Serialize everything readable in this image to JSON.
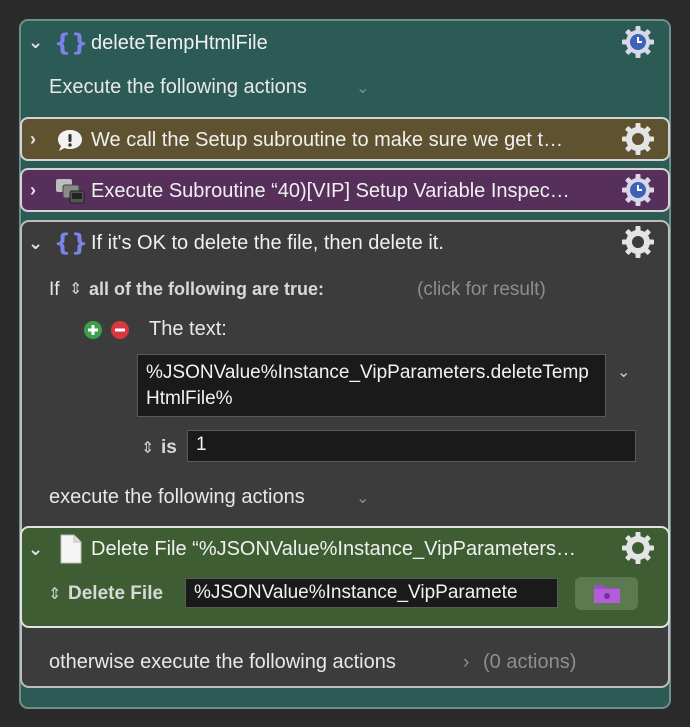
{
  "group": {
    "title": "deleteTempHtmlFile",
    "execute_label": "Execute the following actions",
    "icon": "braces-icon"
  },
  "actions": [
    {
      "title": "We call the Setup subroutine to make sure we get t…",
      "icon": "comment-icon",
      "color": "#5e5230"
    },
    {
      "title": "Execute Subroutine “40)[VIP] Setup Variable Inspec…",
      "icon": "subroutine-icon",
      "color": "#56305a"
    }
  ],
  "condition": {
    "title": "If it's OK to delete the file, then delete it.",
    "if_label": "If",
    "match_label": "all of the following are true:",
    "result_hint": "(click for result)",
    "text_label": "The text:",
    "text_value": "%JSONValue%Instance_VipParameters.deleteTempHtmlFile%",
    "op_label": "is",
    "compare_value": "1",
    "then_label": "execute the following actions",
    "otherwise_label": "otherwise execute the following actions",
    "otherwise_count": "(0 actions)"
  },
  "delete_action": {
    "title": "Delete File “%JSONValue%Instance_VipParameters…",
    "field_label": "Delete File",
    "path_value": "%JSONValue%Instance_VipParamete",
    "color": "#3f5d33"
  }
}
